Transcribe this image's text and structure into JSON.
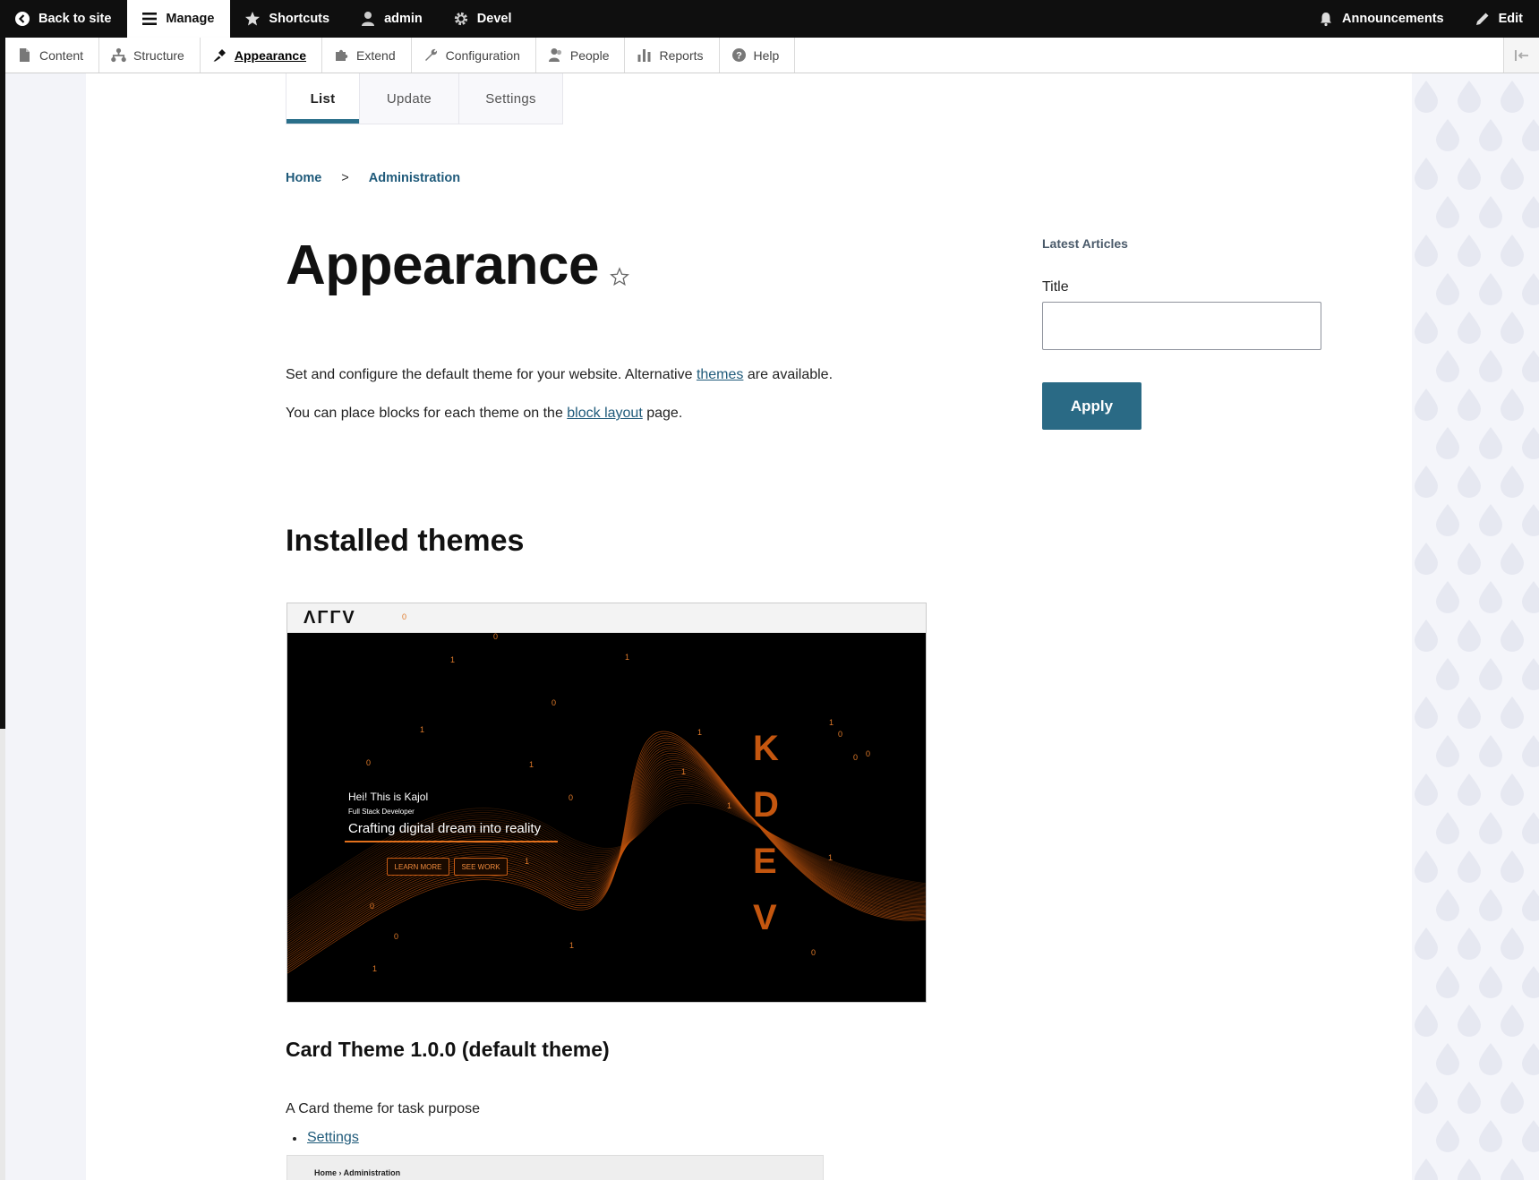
{
  "toolbar": {
    "back": "Back to site",
    "manage": "Manage",
    "shortcuts": "Shortcuts",
    "user": "admin",
    "devel": "Devel",
    "announcements": "Announcements",
    "edit": "Edit"
  },
  "tray": {
    "items": [
      "Content",
      "Structure",
      "Appearance",
      "Extend",
      "Configuration",
      "People",
      "Reports",
      "Help"
    ],
    "active": "Appearance"
  },
  "tabs": [
    "List",
    "Update",
    "Settings"
  ],
  "breadcrumb": [
    "Home",
    "Administration"
  ],
  "page_title": "Appearance",
  "description": {
    "line1_before": "Set and configure the default theme for your website. Alternative ",
    "line1_link": "themes",
    "line1_after": " are available.",
    "line2_before": "You can place blocks for each theme on the ",
    "line2_link": "block layout",
    "line2_after": " page."
  },
  "sidebar": {
    "heading": "Latest Articles",
    "title_label": "Title",
    "title_value": "",
    "apply": "Apply"
  },
  "installed_heading": "Installed themes",
  "theme_preview": {
    "greeting": "Hei! This is Kajol",
    "role": "Full Stack Developer",
    "tagline": "Crafting digital dream into reality",
    "btn_learn": "LEARN MORE",
    "btn_work": "SEE WORK",
    "kdev": [
      "K",
      "D",
      "E",
      "V"
    ]
  },
  "theme": {
    "name": "Card Theme 1.0.0 (default theme)",
    "description": "A Card theme for task purpose",
    "settings_link": "Settings"
  },
  "second_preview": {
    "breadcrumb": "Home  ›  Administration"
  },
  "colors": {
    "accent": "#2a6f8a",
    "link": "#1f5a7a",
    "toolbar": "#0f0f0f",
    "orange": "#e2701c"
  }
}
